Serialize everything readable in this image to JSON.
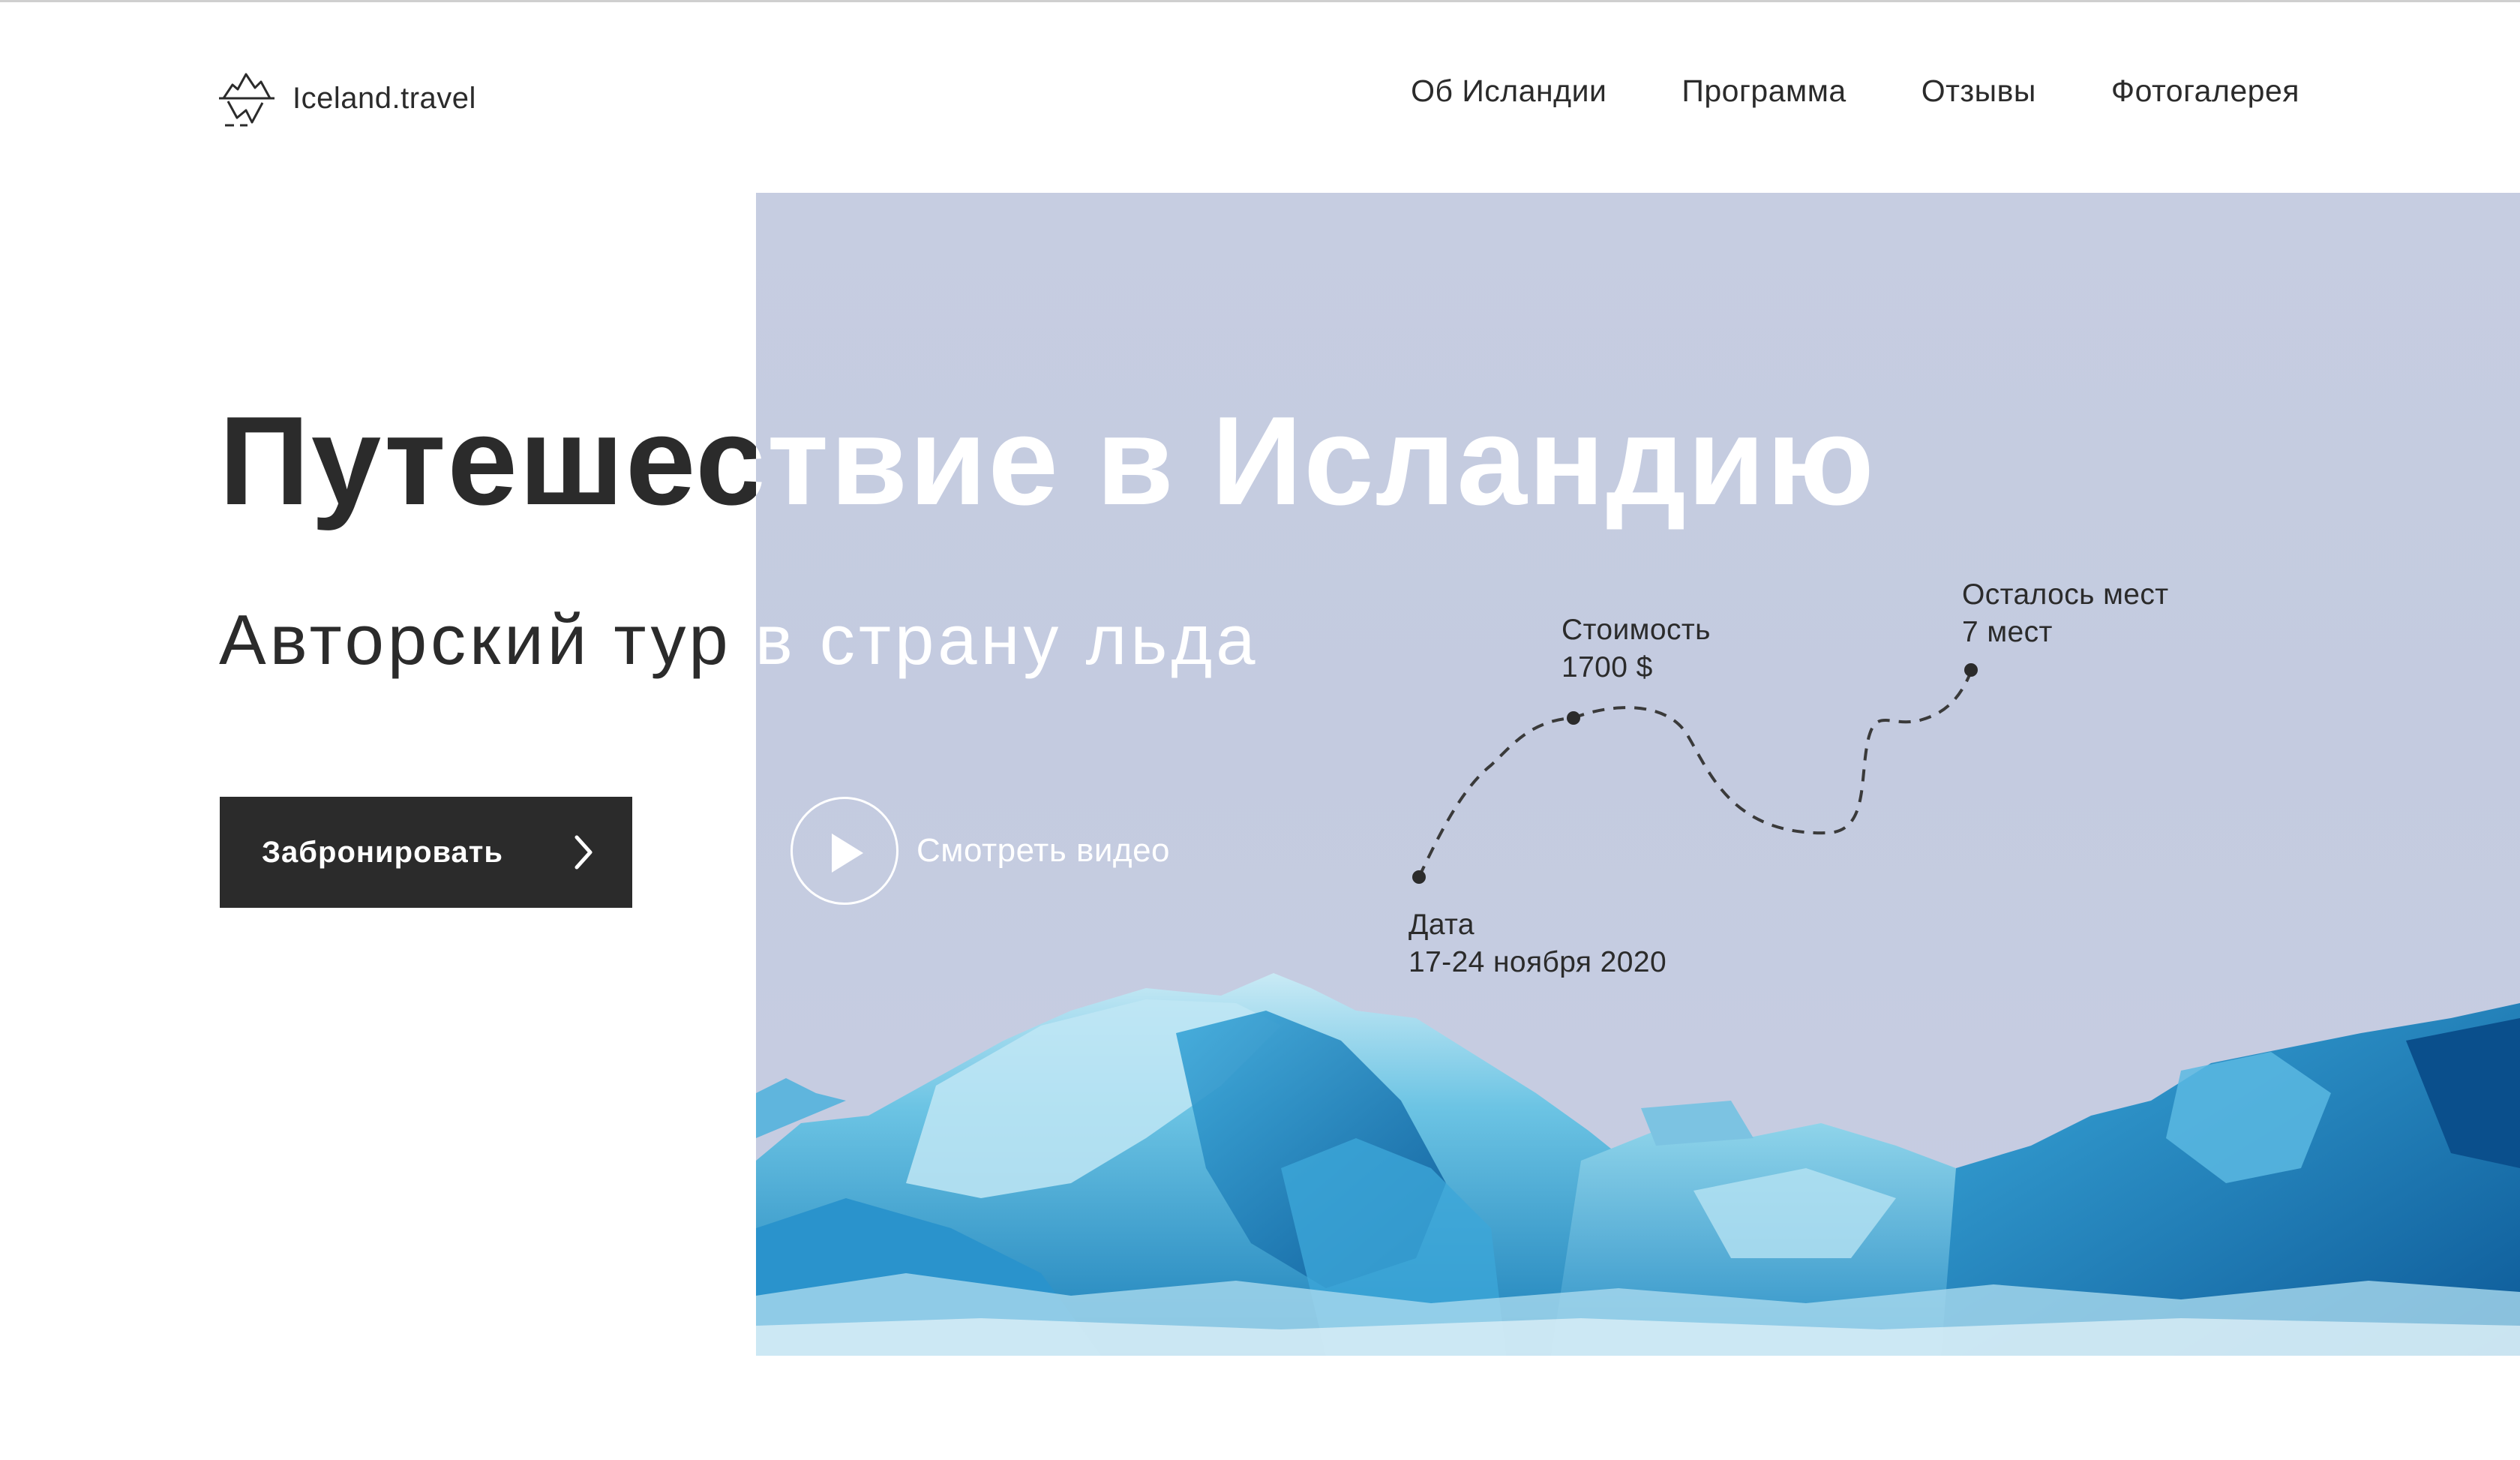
{
  "header": {
    "logo_text": "Iceland.travel",
    "logo_icon": "iceberg-icon",
    "nav": [
      {
        "label": "Об Исландии"
      },
      {
        "label": "Программа"
      },
      {
        "label": "Отзывы"
      },
      {
        "label": "Фотогалерея"
      }
    ]
  },
  "hero": {
    "title_part1": "Путешес",
    "title_part2": "твие в Исландию",
    "subtitle_part1": "Авторский тур",
    "subtitle_part2": " в страну льда",
    "book_label": "Забронировать",
    "book_icon": "chevron-right-icon",
    "video_label": "Смотреть видео",
    "video_icon": "play-icon"
  },
  "tour_info": {
    "date_label": "Дата",
    "date_value": "17-24 ноября 2020",
    "price_label": "Стоимость",
    "price_value": "1700 $",
    "seats_label": "Осталось мест",
    "seats_value": "7 мест"
  },
  "colors": {
    "text_dark": "#2b2b2b",
    "button_bg": "#2b2b2b",
    "sky": "#c6cde1",
    "ice_light": "#8fd4ea",
    "ice_deep": "#1c6fae"
  }
}
